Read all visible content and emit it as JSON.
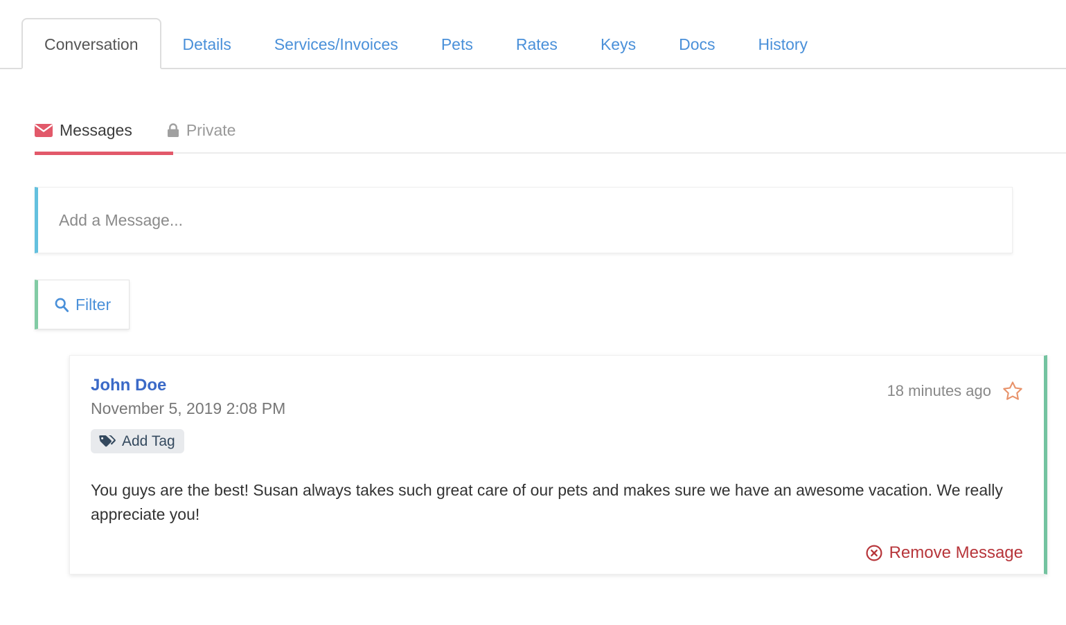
{
  "tabs": [
    {
      "label": "Conversation",
      "active": true
    },
    {
      "label": "Details",
      "active": false
    },
    {
      "label": "Services/Invoices",
      "active": false
    },
    {
      "label": "Pets",
      "active": false
    },
    {
      "label": "Rates",
      "active": false
    },
    {
      "label": "Keys",
      "active": false
    },
    {
      "label": "Docs",
      "active": false
    },
    {
      "label": "History",
      "active": false
    }
  ],
  "subtabs": {
    "messages": {
      "label": "Messages",
      "icon": "envelope-icon",
      "color": "#e2596a",
      "active": true
    },
    "private": {
      "label": "Private",
      "icon": "lock-icon",
      "color": "#999999",
      "active": false
    }
  },
  "compose": {
    "placeholder": "Add a Message...",
    "value": "",
    "accent_color": "#63c0de"
  },
  "filter": {
    "label": "Filter",
    "icon": "search-icon",
    "accent_color": "#82cba4"
  },
  "message": {
    "author": "John Doe",
    "timestamp": "November 5, 2019 2:08 PM",
    "relative_time": "18 minutes ago",
    "star": {
      "icon": "star-outline-icon",
      "color": "#e8926a",
      "filled": false
    },
    "tag_button": {
      "label": "Add Tag",
      "icon": "tags-icon"
    },
    "body": "You guys are the best! Susan always takes such great care of our pets and makes sure we have an awesome vacation. We really appreciate you!",
    "remove": {
      "label": "Remove Message",
      "icon": "times-circle-icon",
      "color": "#b7353a"
    },
    "accent_color": "#74c3a0"
  }
}
